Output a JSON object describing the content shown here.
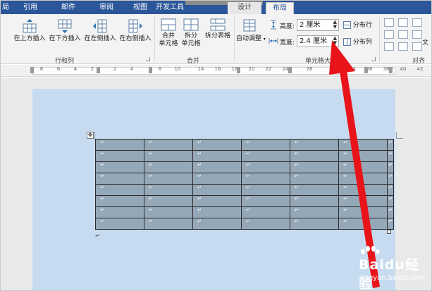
{
  "ribbon_tabs": {
    "t0": "局",
    "t1": "引用",
    "t2": "邮件",
    "t3": "审阅",
    "t4": "视图",
    "t5": "开发工具",
    "design": "设计",
    "layout": "布局"
  },
  "ribbon": {
    "insert_above": "在上方插入",
    "insert_below": "在下方插入",
    "insert_left": "在左侧插入",
    "insert_right": "在右侧插入",
    "rows_cols_group": "行和列",
    "merge_cells": [
      "合并",
      "单元格"
    ],
    "split_cells": [
      "拆分",
      "单元格"
    ],
    "split_table": "拆分表格",
    "merge_group": "合并",
    "autofit": "自动调整",
    "height_label": "高度:",
    "height_value": "2 厘米",
    "width_label": "宽度:",
    "width_value": "2.4 厘米",
    "distribute_rows": "分布行",
    "distribute_cols": "分布列",
    "cell_size_group": "单元格大小",
    "align_group": "对齐",
    "text_dir": "文"
  },
  "ruler": {
    "ticks": [
      "8",
      "6",
      "4",
      "2",
      "2",
      "4",
      "8",
      "10",
      "14",
      "16",
      "18",
      "20",
      "22",
      "24",
      "28",
      "32",
      "34",
      "36",
      "38",
      "40",
      "42"
    ]
  },
  "document": {
    "paragraph_mark": "↵",
    "move_handle": "✥",
    "table": {
      "row_count": 8,
      "column_count": 6
    }
  },
  "watermark": {
    "brand": "Baidu经验",
    "url": "jingyan.baidu.com"
  },
  "colors": {
    "ribbon_tab_bar": "#2b579a",
    "ribbon_bg": "#f3f3f3",
    "page_bg": "#c7dbf0",
    "table_fill": "#95a8b8",
    "arrow": "#e8141a"
  }
}
